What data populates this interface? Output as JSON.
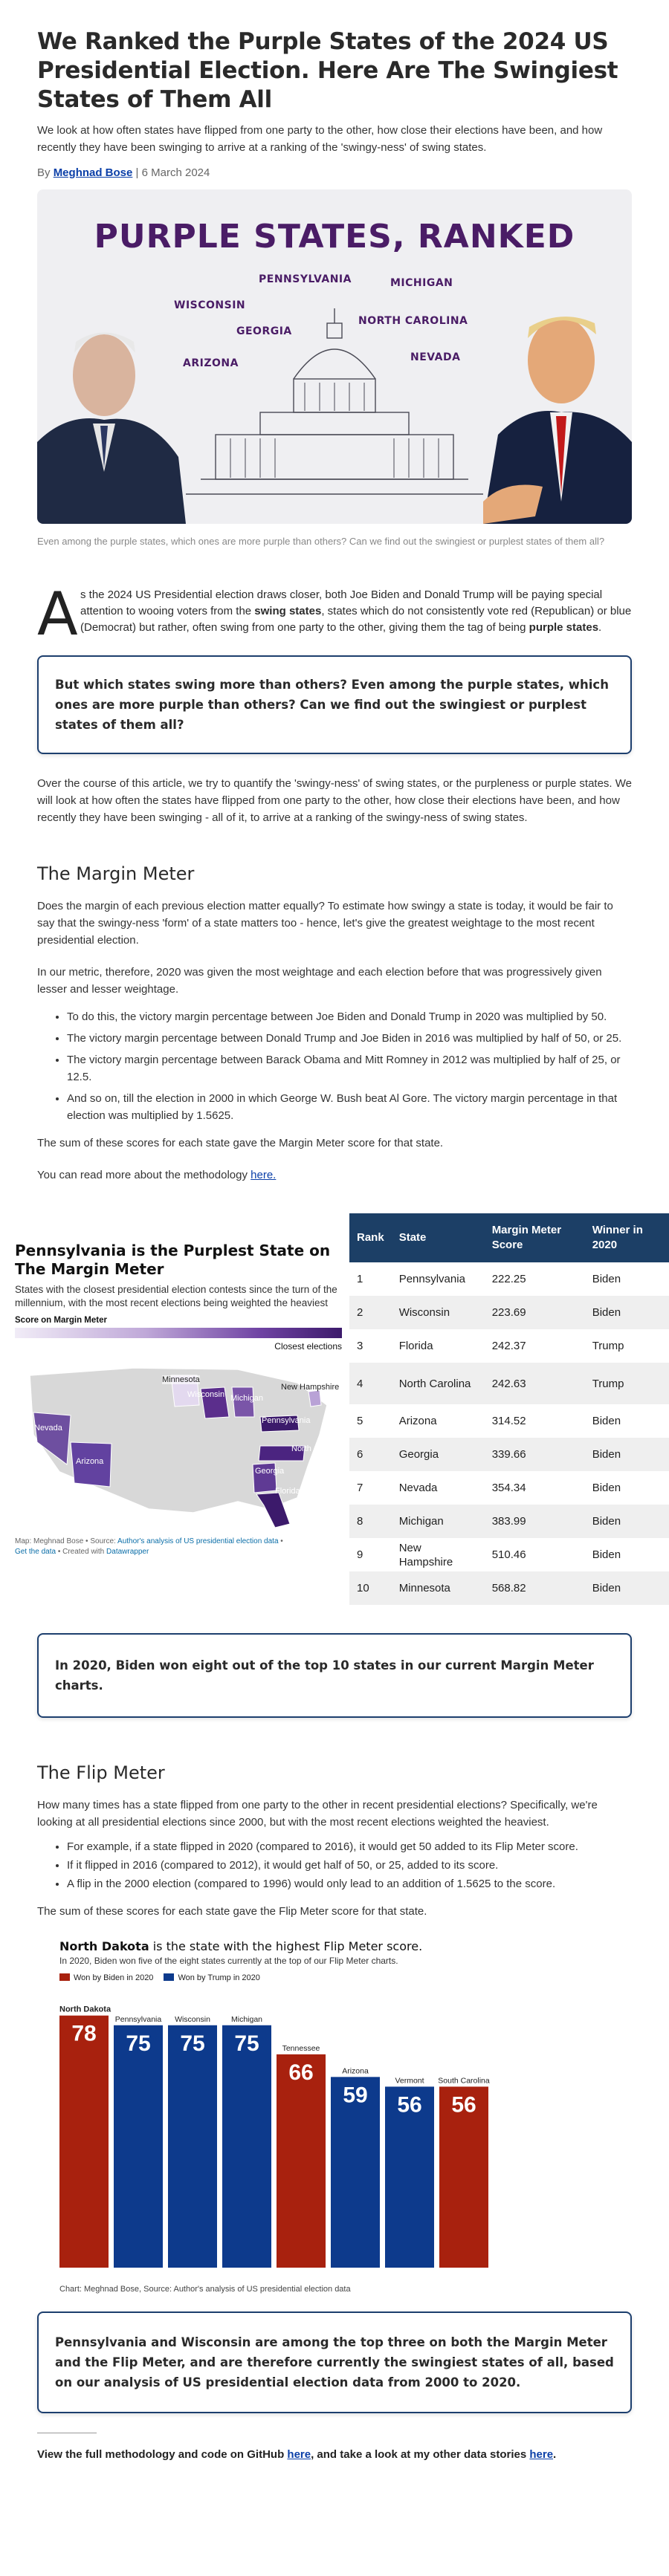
{
  "article": {
    "title": "We Ranked the Purple States of the 2024 US Presidential Election. Here Are The Swingiest States of Them All",
    "dek": "We look at how often states have flipped from one party to the other, how close their elections have been, and how recently they have been swinging to arrive at a ranking of the 'swingy-ness' of swing states.",
    "by_prefix": "By",
    "author": "Meghnad Bose",
    "date": "6 March 2024"
  },
  "hero": {
    "title": "PURPLE STATES, RANKED",
    "states": [
      "PENNSYLVANIA",
      "MICHIGAN",
      "WISCONSIN",
      "NORTH CAROLINA",
      "GEORGIA",
      "ARIZONA",
      "NEVADA"
    ],
    "caption": "Even among the purple states, which ones are more purple than others? Can we find out the swingiest or purplest states of them all?"
  },
  "intro": {
    "dropcap": "A",
    "p1_a": "s the 2024 US Presidential election draws closer, both Joe Biden and Donald Trump will be paying special attention to wooing voters from the ",
    "p1_b": "swing states",
    "p1_c": ", states which do not consistently vote red (Republican) or blue (Democrat) but rather, often swing from one party to the other, giving them the tag of being ",
    "p1_d": "purple states",
    "p1_e": ".",
    "callout1": "But which states swing more than others? Even among the purple states, which ones are more purple than others? Can we find out the swingiest or purplest states of them all?",
    "p2": "Over the course of this article, we try to quantify the 'swingy-ness' of swing states, or the purpleness or purple states. We will look at how often the states have flipped from one party to the other, how close their elections have been, and how recently they have been swinging - all of it, to arrive at a ranking of the swingy-ness of swing states."
  },
  "margin": {
    "heading": "The Margin Meter",
    "p1": "Does the margin of each previous election matter equally? To estimate how swingy a state is today, it would be fair to say that the swingy-ness 'form' of a state matters too - hence, let's give the greatest weightage to the most recent presidential election.",
    "p2": "In our metric, therefore, 2020 was given the most weightage and each election before that was progressively given lesser and lesser weightage.",
    "bullets": [
      "To do this, the victory margin percentage between Joe Biden and Donald Trump in 2020 was multiplied by 50.",
      "The victory margin percentage between Donald Trump and Joe Biden in 2016 was multiplied by half of 50, or 25.",
      "The victory margin percentage between Barack Obama and Mitt Romney in 2012 was multiplied by half of 25, or 12.5.",
      "And so on, till the election in 2000 in which George W. Bush beat Al Gore. The victory margin percentage in that election was multiplied by 1.5625."
    ],
    "p3": "The sum of these scores for each state gave the Margin Meter score for that state.",
    "p4_a": "You can read more about the methodology ",
    "p4_link": "here.",
    "callout": "In 2020, Biden won eight out of the top 10 states in our current Margin Meter charts."
  },
  "map": {
    "title": "Pennsylvania is the Purplest State on The Margin Meter",
    "subtitle": "States with the closest presidential election contests since the turn of the millennium, with the most recent elections being weighted the heaviest",
    "score_label": "Score on Margin Meter",
    "legend_right": "Closest elections",
    "labels": [
      "Minnesota",
      "Wisconsin",
      "Michigan",
      "New Hampshire",
      "Pennsylvania",
      "Nevada",
      "Arizona",
      "North Carolina",
      "Georgia",
      "Florida"
    ],
    "source_a": "Map: Meghnad Bose • Source: ",
    "source_link": "Author's analysis of US presidential election data",
    "source_b": " • ",
    "get_data": "Get the data",
    "created": " • Created with ",
    "dw": "Datawrapper"
  },
  "table": {
    "headers": [
      "Rank",
      "State",
      "Margin Meter Score",
      "Winner in 2020"
    ],
    "rows": [
      [
        "1",
        "Pennsylvania",
        "222.25",
        "Biden"
      ],
      [
        "2",
        "Wisconsin",
        "223.69",
        "Biden"
      ],
      [
        "3",
        "Florida",
        "242.37",
        "Trump"
      ],
      [
        "4",
        "North Carolina",
        "242.63",
        "Trump"
      ],
      [
        "5",
        "Arizona",
        "314.52",
        "Biden"
      ],
      [
        "6",
        "Georgia",
        "339.66",
        "Biden"
      ],
      [
        "7",
        "Nevada",
        "354.34",
        "Biden"
      ],
      [
        "8",
        "Michigan",
        "383.99",
        "Biden"
      ],
      [
        "9",
        "New Hampshire",
        "510.46",
        "Biden"
      ],
      [
        "10",
        "Minnesota",
        "568.82",
        "Biden"
      ]
    ]
  },
  "flip": {
    "heading": "The Flip Meter",
    "p1": "How many times has a state flipped from one party to the other in recent presidential elections? Specifically, we're looking at all presidential elections since 2000, but with the most recent elections weighted the heaviest.",
    "bullets": [
      "For example, if a state flipped in 2020 (compared to 2016), it would get 50 added to its Flip Meter score.",
      "If it flipped in 2016 (compared to 2012), it would get half of 50, or 25, added to its score.",
      "A flip in the 2000 election (compared to 1996) would only lead to an addition of 1.5625 to the score."
    ],
    "p2": "The sum of these scores for each state gave the Flip Meter score for that state.",
    "chart_title_bold": "North Dakota",
    "chart_title_rest": " is the state with the highest Flip Meter score.",
    "chart_sub": "In 2020, Biden won five of the eight states currently at the top of our Flip Meter charts.",
    "legend_biden": "Won by Biden in 2020",
    "legend_trump": "Won by Trump in 2020",
    "chart_source": "Chart: Meghnad Bose, Source: Author's analysis of US presidential election data",
    "callout": "Pennsylvania and Wisconsin are among the top three on both the Margin Meter and the Flip Meter, and are therefore currently the swingiest states of all, based on our analysis of US presidential election data from 2000 to 2020."
  },
  "chart_data": {
    "type": "bar",
    "title": "North Dakota is the state with the highest Flip Meter score.",
    "subtitle": "In 2020, Biden won five of the eight states currently at the top of our Flip Meter charts.",
    "categories": [
      "North Dakota",
      "Pennsylvania",
      "Wisconsin",
      "Michigan",
      "Tennessee",
      "Arizona",
      "Vermont",
      "South Carolina"
    ],
    "values": [
      78,
      75,
      75,
      75,
      66,
      59,
      56,
      56
    ],
    "winner_2020": [
      "Trump",
      "Biden",
      "Biden",
      "Biden",
      "Trump",
      "Biden",
      "Biden",
      "Trump"
    ],
    "legend": [
      "Won by Biden in 2020",
      "Won by Trump in 2020"
    ],
    "colors": {
      "Biden": "#0d3a8c",
      "Trump": "#a8210e"
    },
    "xlabel": "",
    "ylabel": "",
    "ylim": [
      0,
      80
    ],
    "legend_position": "top-left"
  },
  "footer": {
    "a": "View the full methodology and code on GitHub ",
    "link1": "here",
    "b": ", and take a look at my other data stories ",
    "link2": "here",
    "c": "."
  }
}
